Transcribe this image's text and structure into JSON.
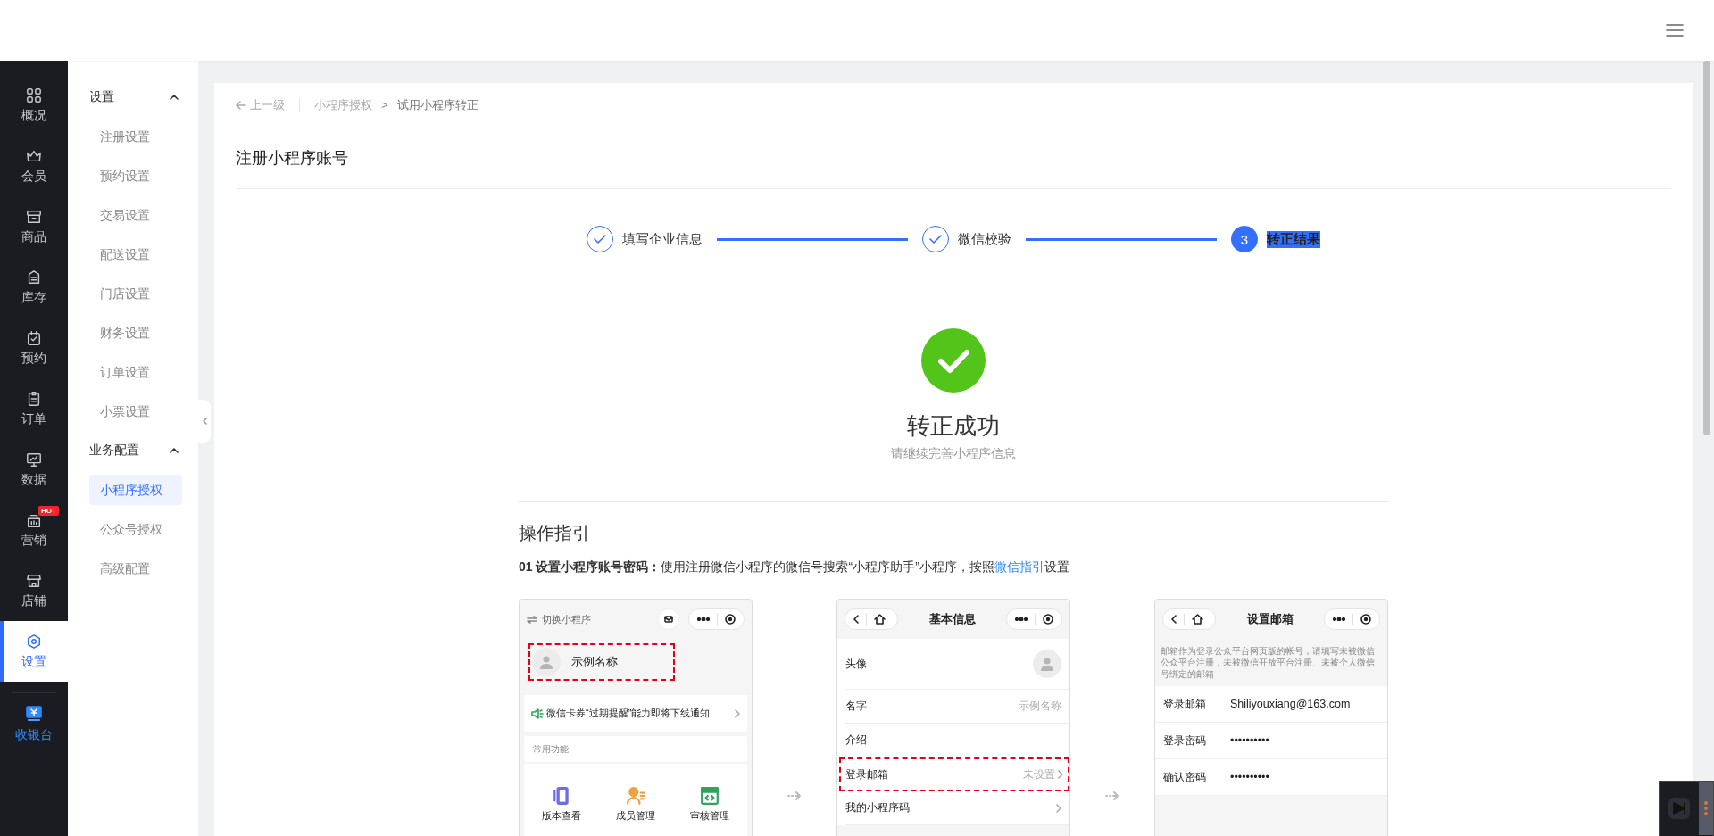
{
  "nav": {
    "items": [
      {
        "label": "概况",
        "selected": false
      },
      {
        "label": "会员",
        "selected": false
      },
      {
        "label": "商品",
        "selected": false
      },
      {
        "label": "库存",
        "selected": false
      },
      {
        "label": "预约",
        "selected": false
      },
      {
        "label": "订单",
        "selected": false
      },
      {
        "label": "数据",
        "selected": false
      },
      {
        "label": "营销",
        "badge": "HOT",
        "selected": false
      },
      {
        "label": "店铺",
        "selected": false
      },
      {
        "label": "设置",
        "selected": true
      }
    ],
    "cashier": {
      "label": "收银台"
    }
  },
  "subnav": [
    {
      "title": "设置",
      "expanded": true,
      "items": [
        {
          "label": "注册设置",
          "selected": false
        },
        {
          "label": "预约设置",
          "selected": false
        },
        {
          "label": "交易设置",
          "selected": false
        },
        {
          "label": "配送设置",
          "selected": false
        },
        {
          "label": "门店设置",
          "selected": false
        },
        {
          "label": "财务设置",
          "selected": false
        },
        {
          "label": "订单设置",
          "selected": false
        },
        {
          "label": "小票设置",
          "selected": false
        }
      ]
    },
    {
      "title": "业务配置",
      "expanded": true,
      "items": [
        {
          "label": "小程序授权",
          "selected": true
        },
        {
          "label": "公众号授权",
          "selected": false
        },
        {
          "label": "高级配置",
          "selected": false
        }
      ]
    }
  ],
  "breadcrumb": {
    "back": "上一级",
    "items": [
      "小程序授权",
      "试用小程序转正"
    ],
    "separator": ">"
  },
  "page_title": "注册小程序账号",
  "steps": [
    {
      "label": "填写企业信息",
      "completed": true,
      "active": false
    },
    {
      "label": "微信校验",
      "completed": true,
      "active": false
    },
    {
      "label": "转正结果",
      "number": "3",
      "completed": false,
      "active": true
    }
  ],
  "result": {
    "success": true,
    "title": "转正成功",
    "subtitle": "请继续完善小程序信息"
  },
  "guide": {
    "title": "操作指引",
    "instruction": {
      "text": "**01 设置小程序账号密码：**使用注册微信小程序的微信号搜索“小程序助手”小程序，按照",
      "link": "微信指引",
      "text_after": "设置"
    }
  },
  "phones": [
    {
      "kind": "assistant",
      "switch_label": "切换小程序",
      "profile": {
        "name": "示例名称",
        "highlighted": true
      },
      "notice": "微信卡券“过期提醒”能力即将下线通知",
      "section": "常用功能",
      "functions": [
        {
          "label": "版本查看",
          "color": "#6b6fe0"
        },
        {
          "label": "成员管理",
          "color": "#f0a040"
        },
        {
          "label": "审核管理",
          "color": "#2fa45a"
        }
      ]
    },
    {
      "kind": "form",
      "title": "基本信息",
      "rows": [
        {
          "kind": "avatar",
          "label": "头像",
          "highlighted": false
        },
        {
          "kind": "text",
          "label": "名字",
          "value": "示例名称",
          "highlighted": false
        },
        {
          "kind": "text",
          "label": "介绍",
          "highlighted": false
        },
        {
          "kind": "link",
          "label": "登录邮箱",
          "value": "未设置",
          "highlighted": true
        },
        {
          "kind": "link",
          "label": "我的小程序码",
          "highlighted": false
        }
      ]
    },
    {
      "kind": "form",
      "title": "设置邮箱",
      "description": "邮箱作为登录公众平台网页版的帐号，请填写未被微信公众平台注册，未被微信开放平台注册、未被个人微信号绑定的邮箱",
      "rows": [
        {
          "kind": "field",
          "label": "登录邮箱",
          "value": "Shiliyouxiang@163.com",
          "highlighted": false
        },
        {
          "kind": "field",
          "label": "登录密码",
          "value": "••••••••••",
          "highlighted": false
        },
        {
          "kind": "field",
          "label": "确认密码",
          "value": "••••••••••",
          "highlighted": false
        }
      ]
    }
  ]
}
